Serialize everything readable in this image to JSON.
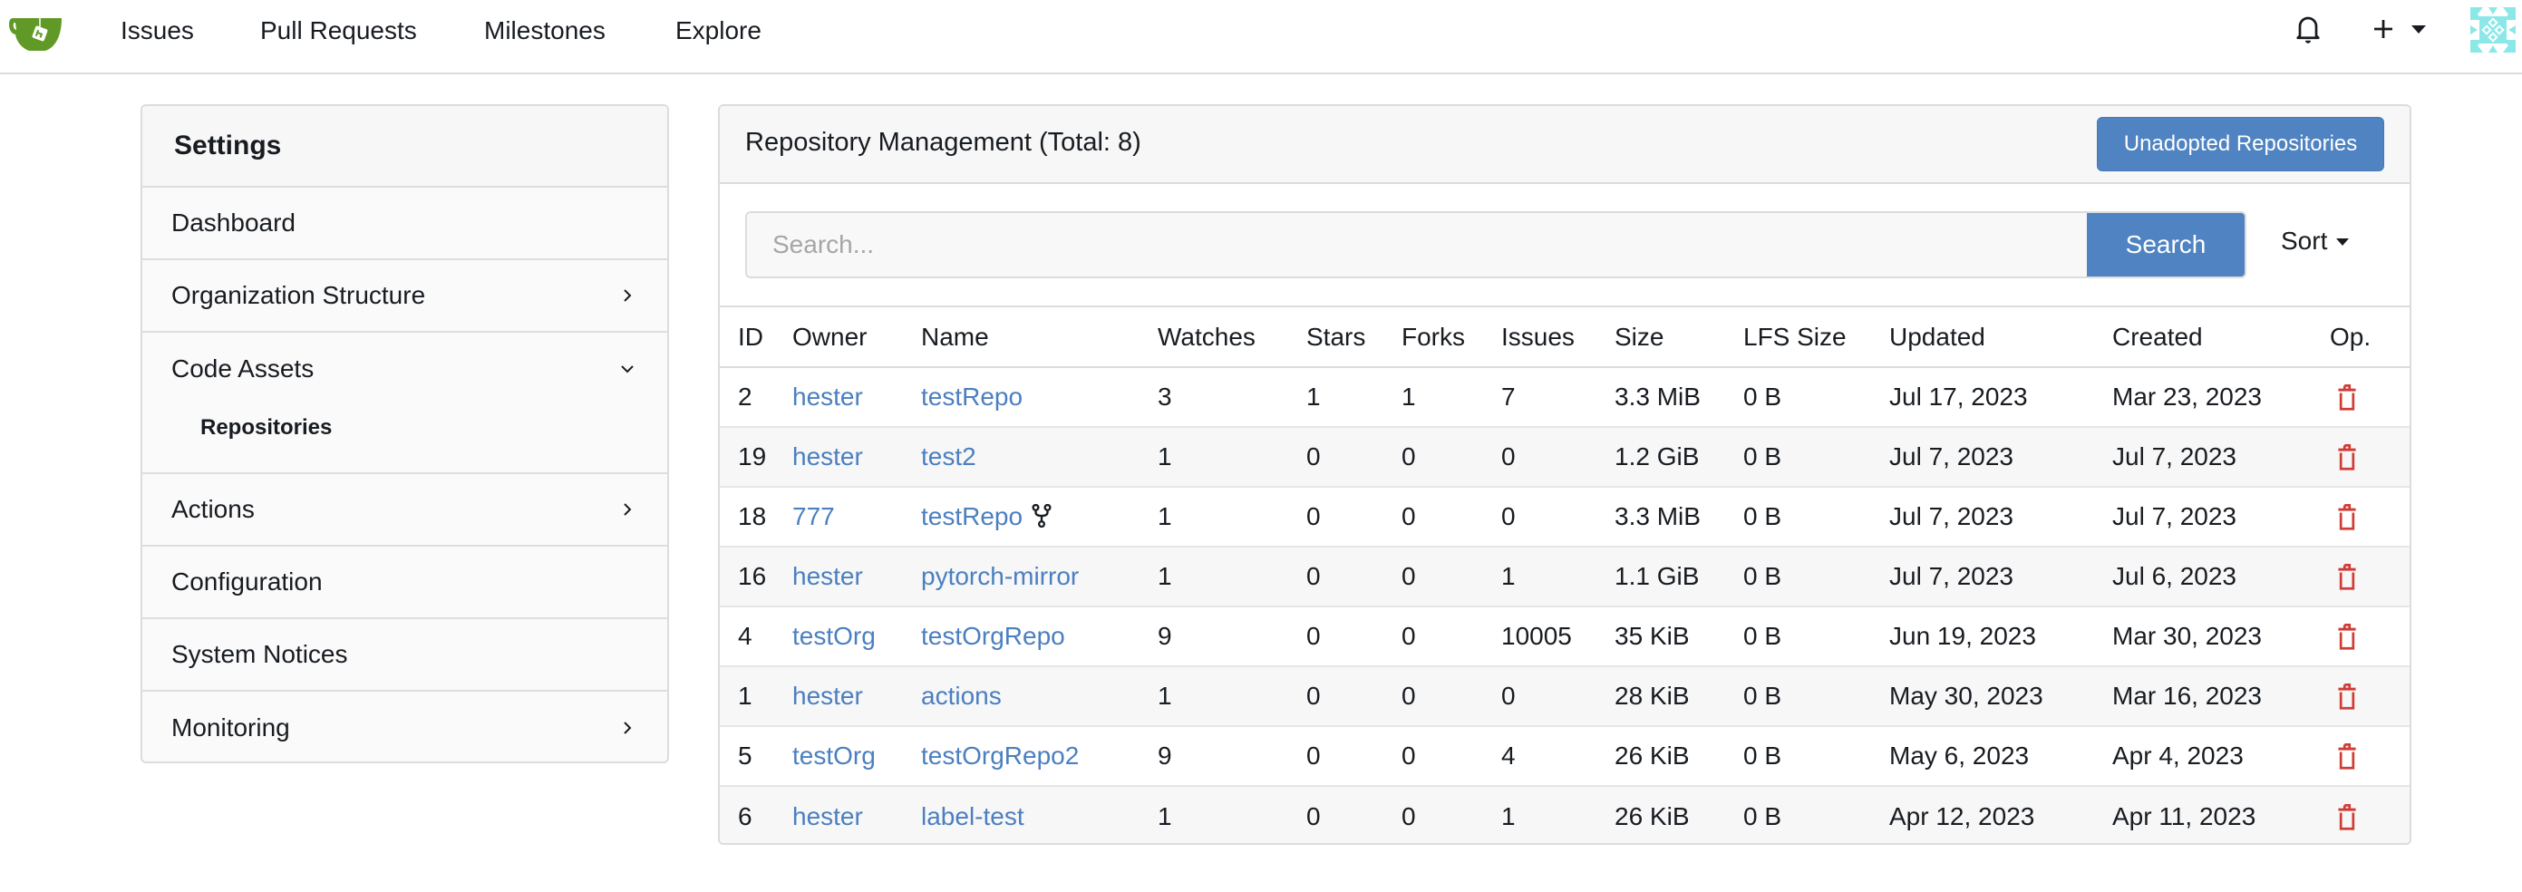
{
  "navbar": {
    "logo": "gitea-logo",
    "items": [
      {
        "label": "Issues"
      },
      {
        "label": "Pull Requests"
      },
      {
        "label": "Milestones"
      },
      {
        "label": "Explore"
      }
    ],
    "right_icons": [
      "bell-icon",
      "plus-icon",
      "avatar"
    ]
  },
  "sidebar": {
    "title": "Settings",
    "items": [
      {
        "label": "Dashboard",
        "chevron": ""
      },
      {
        "label": "Organization Structure",
        "chevron": "right"
      },
      {
        "label": "Code Assets",
        "chevron": "down",
        "children": [
          {
            "label": "Repositories"
          }
        ]
      },
      {
        "label": "Actions",
        "chevron": "right"
      },
      {
        "label": "Configuration",
        "chevron": ""
      },
      {
        "label": "System Notices",
        "chevron": ""
      },
      {
        "label": "Monitoring",
        "chevron": "right"
      }
    ]
  },
  "main": {
    "title": "Repository Management (Total: 8)",
    "unadopted_button": "Unadopted Repositories",
    "search": {
      "placeholder": "Search...",
      "value": "",
      "button": "Search"
    },
    "sort_label": "Sort",
    "colors": {
      "accent": "#4f83c1",
      "link": "#4b7fc0",
      "danger": "#d03d37"
    },
    "table": {
      "columns": [
        "ID",
        "Owner",
        "Name",
        "Watches",
        "Stars",
        "Forks",
        "Issues",
        "Size",
        "LFS Size",
        "Updated",
        "Created",
        "Op."
      ],
      "rows": [
        {
          "id": "2",
          "owner": "hester",
          "name": "testRepo",
          "fork": false,
          "watches": "3",
          "stars": "1",
          "forks": "1",
          "issues": "7",
          "size": "3.3 MiB",
          "lfs": "0 B",
          "updated": "Jul 17, 2023",
          "created": "Mar 23, 2023"
        },
        {
          "id": "19",
          "owner": "hester",
          "name": "test2",
          "fork": false,
          "watches": "1",
          "stars": "0",
          "forks": "0",
          "issues": "0",
          "size": "1.2 GiB",
          "lfs": "0 B",
          "updated": "Jul 7, 2023",
          "created": "Jul 7, 2023"
        },
        {
          "id": "18",
          "owner": "777",
          "name": "testRepo",
          "fork": true,
          "watches": "1",
          "stars": "0",
          "forks": "0",
          "issues": "0",
          "size": "3.3 MiB",
          "lfs": "0 B",
          "updated": "Jul 7, 2023",
          "created": "Jul 7, 2023"
        },
        {
          "id": "16",
          "owner": "hester",
          "name": "pytorch-mirror",
          "fork": false,
          "watches": "1",
          "stars": "0",
          "forks": "0",
          "issues": "1",
          "size": "1.1 GiB",
          "lfs": "0 B",
          "updated": "Jul 7, 2023",
          "created": "Jul 6, 2023"
        },
        {
          "id": "4",
          "owner": "testOrg",
          "name": "testOrgRepo",
          "fork": false,
          "watches": "9",
          "stars": "0",
          "forks": "0",
          "issues": "10005",
          "size": "35 KiB",
          "lfs": "0 B",
          "updated": "Jun 19, 2023",
          "created": "Mar 30, 2023"
        },
        {
          "id": "1",
          "owner": "hester",
          "name": "actions",
          "fork": false,
          "watches": "1",
          "stars": "0",
          "forks": "0",
          "issues": "0",
          "size": "28 KiB",
          "lfs": "0 B",
          "updated": "May 30, 2023",
          "created": "Mar 16, 2023"
        },
        {
          "id": "5",
          "owner": "testOrg",
          "name": "testOrgRepo2",
          "fork": false,
          "watches": "9",
          "stars": "0",
          "forks": "0",
          "issues": "4",
          "size": "26 KiB",
          "lfs": "0 B",
          "updated": "May 6, 2023",
          "created": "Apr 4, 2023"
        },
        {
          "id": "6",
          "owner": "hester",
          "name": "label-test",
          "fork": false,
          "watches": "1",
          "stars": "0",
          "forks": "0",
          "issues": "1",
          "size": "26 KiB",
          "lfs": "0 B",
          "updated": "Apr 12, 2023",
          "created": "Apr 11, 2023"
        }
      ]
    }
  }
}
